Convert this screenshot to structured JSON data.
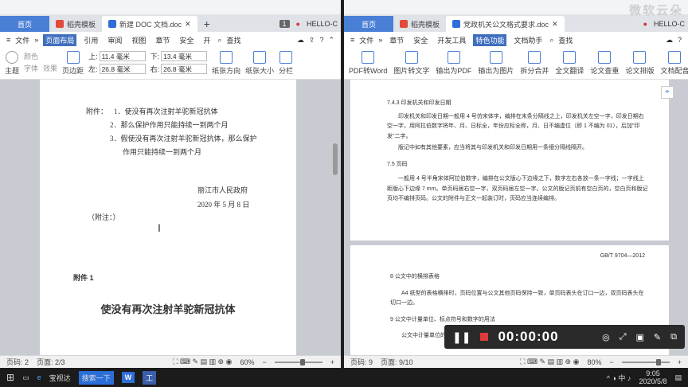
{
  "watermark": "微软云朵",
  "left_window": {
    "tabs": {
      "home": "首页",
      "template": "稻壳模板",
      "doc": "新建 DOC 文档.doc",
      "user": "HELLO-C"
    },
    "menu": {
      "file": "文件",
      "items": [
        "页面布局",
        "引用",
        "审阅",
        "视图",
        "章节",
        "安全",
        "开"
      ],
      "search": "查找"
    },
    "toolbar": {
      "theme": "主题",
      "color": "颜色",
      "font": "字体",
      "effect": "效果",
      "margin": "页边距",
      "top_label": "上:",
      "top_value": "11.4 毫米",
      "bottom_label": "下:",
      "bottom_value": "13.4 毫米",
      "left_label": "左:",
      "left_value": "26.8 毫米",
      "right_label": "右:",
      "right_value": "26.8 毫米",
      "orientation": "纸张方向",
      "size": "纸张大小",
      "columns": "分栏"
    },
    "doc": {
      "att_label": "附件：",
      "att_items": [
        "1．使没有再次注射羊驼新冠抗体",
        "2．那么保护作用只能持续一到两个月",
        "3．假使没有再次注射羊驼新冠抗体，那么保护"
      ],
      "att_item3_cont": "作用只能持续一到两个月",
      "org": "丽江市人民政府",
      "date": "2020 年 5 月 8 日",
      "note": "（附注：）",
      "page2_att": "附件 1",
      "page2_title": "使没有再次注射羊驼新冠抗体"
    },
    "status": {
      "page": "页码: 2",
      "pages": "页面: 2/3",
      "zoom": "60%",
      "zoom_level": 0.6
    }
  },
  "right_window": {
    "tabs": {
      "home": "首页",
      "template": "稻壳模板",
      "doc": "党政机关公文格式要求.doc",
      "user": "HELLO-C"
    },
    "menu": {
      "file": "文件",
      "items": [
        "章节",
        "安全",
        "开发工具",
        "特色功能",
        "文档助手"
      ],
      "search": "查找"
    },
    "toolbar": [
      "PDF转Word",
      "图片转文字",
      "输出为PDF",
      "输出为图片",
      "拆分合并",
      "全文翻译",
      "论文查重",
      "论文排版",
      "文档配音"
    ],
    "doc": {
      "s743": "7.4.3  印发机关和印发日期",
      "p743": "印发机关和印发日期一般用 4 号仿宋体字，编排在末条分隔线之上，印发机关左空一字，印发日期右空一字，用阿拉伯数字将年、月、日标全，年份应标全称，月、日不编虚位（即 1 不编为 01），后加\"印发\"二字。",
      "p743b": "版记中如有其他要素，应当将其与印发机关和印发日期用一条细分隔线隔开。",
      "s75": "7.5  页码",
      "p75": "一般用 4 号半角宋体阿拉伯数字，编排在公文版心下边缘之下，数字左右各放一条一字线；一字线上距版心下边缘 7 mm。单页码居右空一字，双页码居左空一字。公文的版记页前有空白页的，空白页和版记页均不编排页码。公文的附件与正文一起装订时，页码应当连续编排。",
      "header": "GB/T 9704—2012",
      "s8": "8  公文中的横排表格",
      "p8": "A4 纸型的表格横排时，页码位置与公文其他页码保持一致，单页码表头在订口一边，双页码表头在切口一边。",
      "s9": "9  公文中计量单位、标点符号和数字的用法",
      "p9": "公文中计量单位的"
    },
    "status": {
      "page": "页码: 9",
      "pages": "页面: 9/10",
      "zoom": "80%",
      "zoom_level": 0.8
    }
  },
  "recorder": {
    "time": "00:00:00"
  },
  "taskbar": {
    "apps": [
      "宝视达",
      "搜索一下"
    ],
    "time": "9:05",
    "date": "2020/5/8"
  }
}
